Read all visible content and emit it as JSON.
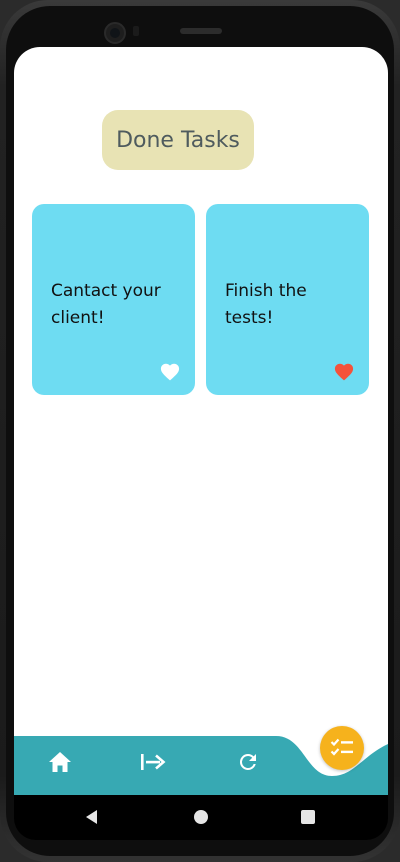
{
  "header": {
    "title": "Done Tasks"
  },
  "tasks": [
    {
      "text": "Cantact your client!",
      "favorite": false
    },
    {
      "text": "Finish the tests!",
      "favorite": true
    }
  ],
  "colors": {
    "card": "#6edcf2",
    "title_chip": "#e8e3b4",
    "bottom_bar": "#37a9b3",
    "fab": "#f6b21c",
    "heart_active": "#f4523b",
    "heart_inactive": "#ffffff"
  },
  "bottom_nav": {
    "items": [
      {
        "icon": "home-icon"
      },
      {
        "icon": "logout-arrow-icon"
      },
      {
        "icon": "refresh-icon"
      }
    ],
    "fab_icon": "checklist-icon"
  },
  "system_nav": {
    "items": [
      {
        "icon": "back-triangle-icon"
      },
      {
        "icon": "home-circle-icon"
      },
      {
        "icon": "recents-square-icon"
      }
    ]
  }
}
